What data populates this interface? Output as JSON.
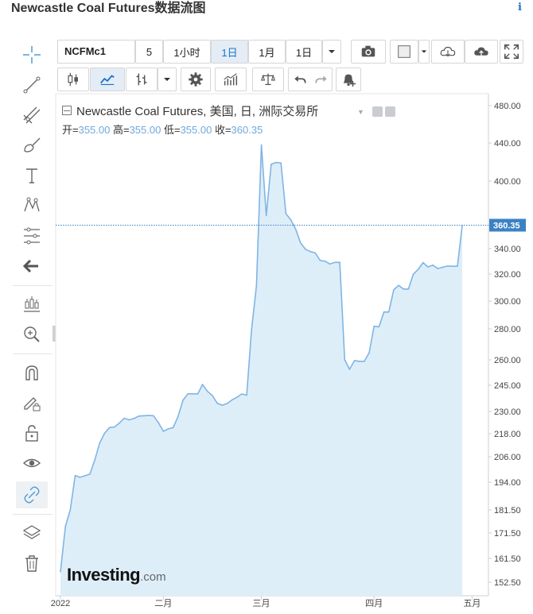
{
  "page": {
    "title": "Newcastle Coal Futures数据流图",
    "info_icon": "i"
  },
  "toolbar": {
    "symbol": "NCFMc1",
    "interval_value": "5",
    "btn_1h": "1小时",
    "btn_1d": "1日",
    "btn_1m": "1月",
    "range": "1日",
    "active": "1日"
  },
  "legend": {
    "title": "Newcastle Coal Futures, 美国, 日, 洲际交易所",
    "open_label": "开=",
    "open": "355.00",
    "high_label": "高=",
    "high": "355.00",
    "low_label": "低=",
    "low": "355.00",
    "close_label": "收=",
    "close": "360.35"
  },
  "logo": {
    "name": "Investing",
    "suffix": ".com"
  },
  "icons": {
    "left": [
      "crosshair-icon",
      "trend-line-icon",
      "pitchfork-icon",
      "brush-icon",
      "text-icon",
      "pattern-icon",
      "fib-icon",
      "back-arrow-icon",
      "measure-icon",
      "zoom-icon",
      "magnet-icon",
      "lock-pencil-icon",
      "unlock-icon",
      "eye-icon",
      "link-icon",
      "layers-icon",
      "trash-icon"
    ],
    "top": [
      "candles-icon",
      "area-icon",
      "bars-icon",
      "gear-icon",
      "indicators-icon",
      "compare-icon",
      "undo-icon",
      "redo-icon",
      "alert-icon",
      "camera-icon",
      "color-icon",
      "cloud-download-icon",
      "cloud-upload-icon",
      "fullscreen-icon"
    ]
  },
  "colors": {
    "line": "#7fb5e4",
    "fill": "#deeef9",
    "price_tag": "#3b82c4",
    "active_tab": "#1a73c9"
  },
  "chart_data": {
    "type": "area",
    "title": "Newcastle Coal Futures, 美国, 日, 洲际交易所",
    "xlabel": "",
    "ylabel": "",
    "last_price": "360.35",
    "y_ticks": [
      "480.00",
      "440.00",
      "400.00",
      "360.00",
      "340.00",
      "320.00",
      "300.00",
      "280.00",
      "260.00",
      "245.00",
      "230.00",
      "218.00",
      "206.00",
      "194.00",
      "181.50",
      "171.50",
      "161.50",
      "152.50"
    ],
    "x_ticks": [
      {
        "label": "2022",
        "index": 0
      },
      {
        "label": "二月",
        "index": 21
      },
      {
        "label": "三月",
        "index": 41
      },
      {
        "label": "四月",
        "index": 64
      },
      {
        "label": "五月",
        "index": 84
      }
    ],
    "values": [
      156.5,
      174.3,
      181.5,
      197.1,
      196.3,
      197.0,
      197.8,
      204.4,
      213.1,
      218.2,
      221.3,
      221.6,
      223.7,
      226.3,
      225.5,
      226.2,
      227.5,
      227.7,
      227.8,
      227.7,
      223.9,
      219.3,
      220.6,
      221.3,
      227.2,
      236.4,
      240.1,
      240.1,
      240.0,
      245.4,
      241.5,
      239.1,
      234.7,
      233.6,
      234.5,
      236.6,
      238.1,
      240.0,
      239.3,
      279.5,
      311.6,
      438.0,
      369.0,
      417.7,
      419.6,
      419.0,
      370.7,
      365.3,
      356.9,
      345.0,
      339.5,
      337.6,
      336.6,
      330.6,
      330.1,
      327.9,
      329.2,
      329.2,
      260.0,
      254.4,
      259.6,
      259.1,
      259.1,
      264.6,
      281.9,
      281.5,
      292.1,
      292.1,
      308.3,
      311.6,
      308.9,
      308.9,
      319.8,
      323.7,
      329.0,
      325.6,
      327.0,
      324.3,
      325.4,
      326.3,
      326.1,
      326.1,
      360.35
    ]
  }
}
